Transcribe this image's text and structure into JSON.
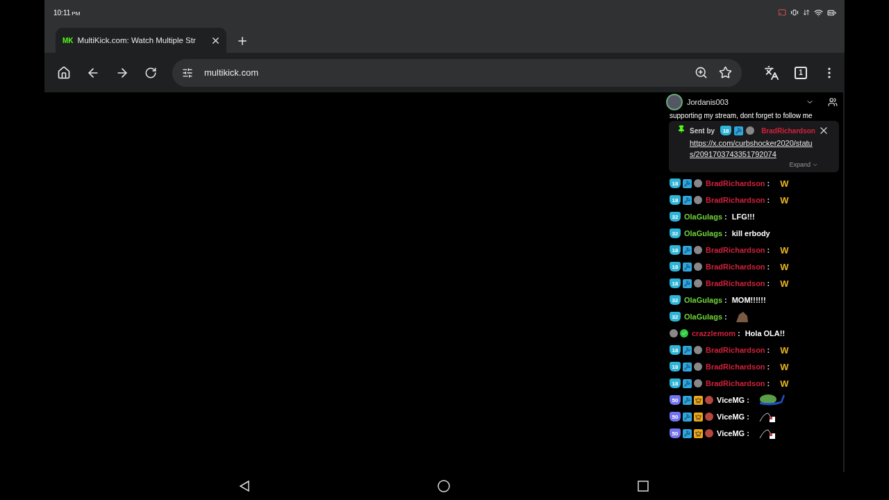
{
  "status_bar": {
    "time": "10:11",
    "meridiem": "PM"
  },
  "separator": ":",
  "tabs": [
    {
      "title": "MultiKick.com: Watch Multiple Str",
      "favicon": "MK",
      "selected": true
    }
  ],
  "toolbar": {
    "url": "multikick.com",
    "tab_count": "1"
  },
  "chat": {
    "channel": "Jordanis003",
    "cut_line": "supporting my stream, dont forget to follow me",
    "pinned": {
      "sent_by": "Sent by",
      "badges": [
        {
          "kind": "sub",
          "label": "18"
        },
        {
          "kind": "mod"
        },
        {
          "kind": "gifter"
        }
      ],
      "user": "BradRichardson",
      "color": "#d0213a",
      "link": "https://x.com/curbshocker2020/status/2091703743351792074",
      "expand": "Expand"
    },
    "messages": [
      {
        "badges": [
          {
            "kind": "sub",
            "label": "18"
          },
          {
            "kind": "mod"
          },
          {
            "kind": "gifter"
          }
        ],
        "user": "BradRichardson",
        "color": "#d0213a",
        "kind": "emote-w",
        "text": "W"
      },
      {
        "badges": [
          {
            "kind": "sub",
            "label": "18"
          },
          {
            "kind": "mod"
          },
          {
            "kind": "gifter"
          }
        ],
        "user": "BradRichardson",
        "color": "#d0213a",
        "kind": "emote-w",
        "text": "W"
      },
      {
        "badges": [
          {
            "kind": "sub",
            "label": "32"
          }
        ],
        "user": "OlaGulags",
        "color": "#6fd33a",
        "kind": "text",
        "text": "LFG!!!"
      },
      {
        "badges": [
          {
            "kind": "sub",
            "label": "32"
          }
        ],
        "user": "OlaGulags",
        "color": "#6fd33a",
        "kind": "text",
        "text": "kill erbody"
      },
      {
        "badges": [
          {
            "kind": "sub",
            "label": "18"
          },
          {
            "kind": "mod"
          },
          {
            "kind": "gifter"
          }
        ],
        "user": "BradRichardson",
        "color": "#d0213a",
        "kind": "emote-w",
        "text": "W"
      },
      {
        "badges": [
          {
            "kind": "sub",
            "label": "18"
          },
          {
            "kind": "mod"
          },
          {
            "kind": "gifter"
          }
        ],
        "user": "BradRichardson",
        "color": "#d0213a",
        "kind": "emote-w",
        "text": "W"
      },
      {
        "badges": [
          {
            "kind": "sub",
            "label": "18"
          },
          {
            "kind": "mod"
          },
          {
            "kind": "gifter"
          }
        ],
        "user": "BradRichardson",
        "color": "#d0213a",
        "kind": "emote-w",
        "text": "W"
      },
      {
        "badges": [
          {
            "kind": "sub",
            "label": "32"
          }
        ],
        "user": "OlaGulags",
        "color": "#6fd33a",
        "kind": "text",
        "text": "MOM!!!!!!"
      },
      {
        "badges": [
          {
            "kind": "sub",
            "label": "32"
          }
        ],
        "user": "OlaGulags",
        "color": "#6fd33a",
        "kind": "emote-rock"
      },
      {
        "badges": [
          {
            "kind": "gifter"
          },
          {
            "kind": "verified"
          }
        ],
        "user": "crazzlemom",
        "color": "#d0213a",
        "kind": "text",
        "text": "Hola OLA!!"
      },
      {
        "badges": [
          {
            "kind": "sub",
            "label": "18"
          },
          {
            "kind": "mod"
          },
          {
            "kind": "gifter"
          }
        ],
        "user": "BradRichardson",
        "color": "#d0213a",
        "kind": "emote-w",
        "text": "W"
      },
      {
        "badges": [
          {
            "kind": "sub",
            "label": "18"
          },
          {
            "kind": "mod"
          },
          {
            "kind": "gifter"
          }
        ],
        "user": "BradRichardson",
        "color": "#d0213a",
        "kind": "emote-w",
        "text": "W"
      },
      {
        "badges": [
          {
            "kind": "sub",
            "label": "18"
          },
          {
            "kind": "mod"
          },
          {
            "kind": "gifter"
          }
        ],
        "user": "BradRichardson",
        "color": "#d0213a",
        "kind": "emote-w",
        "text": "W"
      },
      {
        "badges": [
          {
            "kind": "sub6",
            "label": "50"
          },
          {
            "kind": "mod"
          },
          {
            "kind": "vip"
          },
          {
            "kind": "gifter-red"
          }
        ],
        "user": "ViceMG",
        "color": "#ffffff",
        "kind": "emote-frog"
      },
      {
        "badges": [
          {
            "kind": "sub6",
            "label": "50"
          },
          {
            "kind": "mod"
          },
          {
            "kind": "vip"
          },
          {
            "kind": "gifter-red"
          }
        ],
        "user": "ViceMG",
        "color": "#ffffff",
        "kind": "emote-sketch"
      },
      {
        "badges": [
          {
            "kind": "sub6",
            "label": "50"
          },
          {
            "kind": "mod"
          },
          {
            "kind": "vip"
          },
          {
            "kind": "gifter-red"
          }
        ],
        "user": "ViceMG",
        "color": "#ffffff",
        "kind": "emote-sketch"
      }
    ]
  }
}
